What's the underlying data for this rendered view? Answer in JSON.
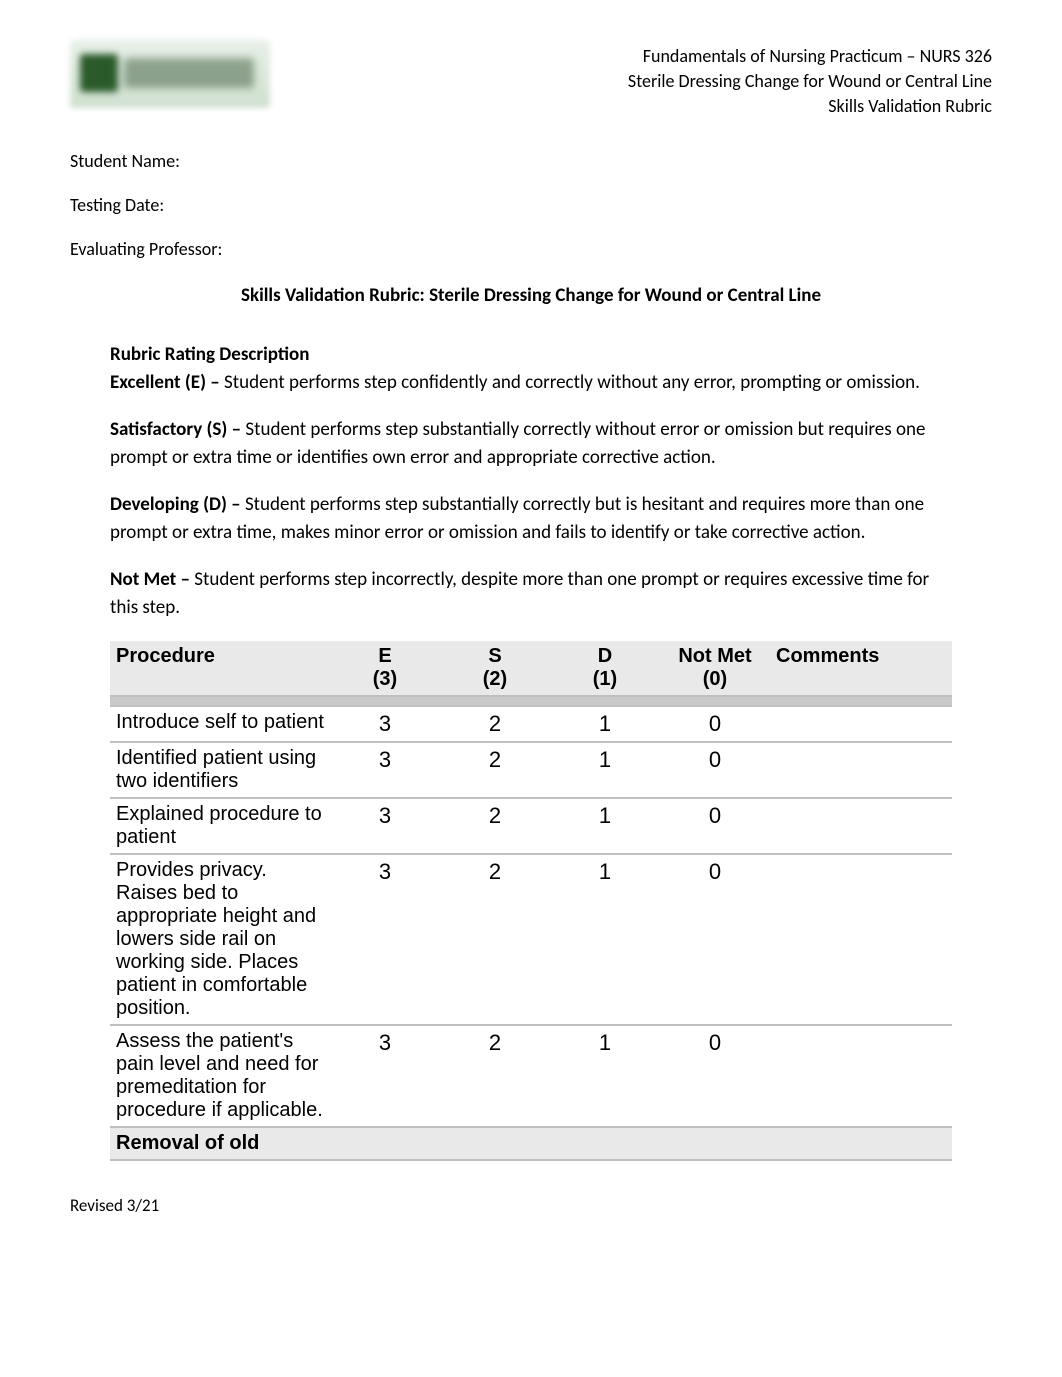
{
  "header": {
    "line1": "Fundamentals of Nursing Practicum – NURS 326",
    "line2": "Sterile Dressing Change for Wound or Central Line",
    "line3": "Skills Validation Rubric"
  },
  "meta": {
    "student_label": "Student Name:",
    "date_label": "Testing Date:",
    "professor_label": "Evaluating Professor:"
  },
  "title": "Skills Validation Rubric: Sterile Dressing Change for Wound or Central Line",
  "rubric": {
    "heading": "Rubric Rating Description",
    "excellent_label": "Excellent (E) – ",
    "excellent_text": "Student performs step confidently and correctly without any error, prompting or omission.",
    "satisfactory_label": "Satisfactory (S) – ",
    "satisfactory_text": "Student performs step substantially correctly without error or omission but requires one prompt or extra time or identifies own error and appropriate corrective action.",
    "developing_label": "Developing (D) – ",
    "developing_text": "Student performs step substantially correctly but is hesitant and requires more than one prompt or extra time, makes minor error or omission and fails to identify or take corrective action.",
    "notmet_label": "Not Met – ",
    "notmet_text": "Student performs step incorrectly, despite more than one prompt or requires excessive time for this step."
  },
  "table": {
    "headers": {
      "procedure": "Procedure",
      "e": "E",
      "e_sub": "(3)",
      "s": "S",
      "s_sub": "(2)",
      "d": "D",
      "d_sub": "(1)",
      "nm": "Not Met",
      "nm_sub": "(0)",
      "comments": "Comments"
    },
    "rows": [
      {
        "procedure": "Introduce self to patient",
        "e": "3",
        "s": "2",
        "d": "1",
        "nm": "0"
      },
      {
        "procedure": "Identified patient using two identifiers",
        "e": "3",
        "s": "2",
        "d": "1",
        "nm": "0"
      },
      {
        "procedure": "Explained procedure to patient",
        "e": "3",
        "s": "2",
        "d": "1",
        "nm": "0"
      },
      {
        "procedure": "Provides privacy. Raises bed to appropriate height and lowers side rail on working side. Places patient in comfortable position.",
        "e": "3",
        "s": "2",
        "d": "1",
        "nm": "0"
      },
      {
        "procedure": "Assess the patient's pain level and need for premeditation for procedure if applicable.",
        "e": "3",
        "s": "2",
        "d": "1",
        "nm": "0"
      }
    ],
    "section_row": "Removal of old"
  },
  "footer": "Revised 3/21"
}
